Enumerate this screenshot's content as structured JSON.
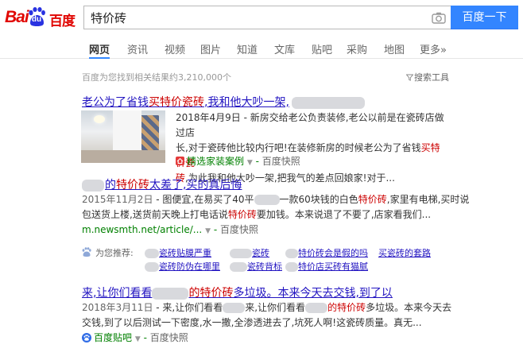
{
  "logo": {
    "bai": "Bai",
    "du": "du",
    "cn": "百度"
  },
  "search": {
    "query": "特价砖",
    "button_label": "百度一下"
  },
  "tabs": [
    "网页",
    "资讯",
    "视频",
    "图片",
    "知道",
    "文库",
    "贴吧",
    "采购",
    "地图",
    "更多»"
  ],
  "stats": {
    "text": "百度为您找到相关结果约3,210,000个",
    "tools": "搜索工具"
  },
  "results": [
    {
      "title_a": "老公为了省钱",
      "title_em": "买特价瓷砖",
      "title_b": ",我和他大吵一架,",
      "line1": "2018年4月9日 - 新房交给老公负责装修,老公以前是在瓷砖店做过店",
      "line2_a": "长,对于瓷砖他比较内行吧!在装修新房的时候老公为了省钱",
      "line2_em": "买特价瓷",
      "line3_em": "砖",
      "line3_b": ",为此我和他大吵一架,把我气的差点回娘家!对于...",
      "source": "精选家装案例",
      "snapshot": "百度快照"
    },
    {
      "title_a": "的",
      "title_em": "特价砖",
      "title_b": "太差了,买的真后悔",
      "line1_date": "2015年11月2日",
      "line1_a": " - 图便宜,在易买了40平",
      "line1_b": "一款60块钱的白色",
      "line1_em": "特价砖",
      "line1_c": ",家里有电梯,买时说",
      "line2_a": "包送货上楼,送货前天晚上打电话说",
      "line2_em": "特价砖",
      "line2_b": "要加钱。本来说退了不要了,店家看我们...",
      "source": "m.newsmth.net/article/...",
      "snapshot": "百度快照"
    },
    {
      "title_a": "来,让你们看看",
      "title_em": "的特价砖",
      "title_b": "多垃圾。本来今天去交钱,到了以",
      "line1_date": "2018年3月11日",
      "line1_a": " - 来,让你们看看",
      "line1_b": "来,让你们看看",
      "line1_em": "的特价砖",
      "line1_c": "多垃圾。本来今天去",
      "line2": "交钱,到了以后测试一下密度,水一撒,全渗透进去了,坑死人啊!这瓷砖质量。真无...",
      "source": "百度贴吧",
      "snapshot": "百度快照"
    }
  ],
  "recommend": {
    "label": "为您推荐:",
    "links": [
      "瓷砖贴膜严重",
      "瓷砖",
      "特价砖会是假的吗",
      "买瓷砖的套路",
      "瓷砖防伪在哪里",
      "瓷砖背标",
      "特价店买砖有猫腻"
    ]
  },
  "colors": {
    "accent": "#3385ff",
    "link": "#2214c1",
    "highlight": "#cc0000",
    "source": "#008000"
  }
}
